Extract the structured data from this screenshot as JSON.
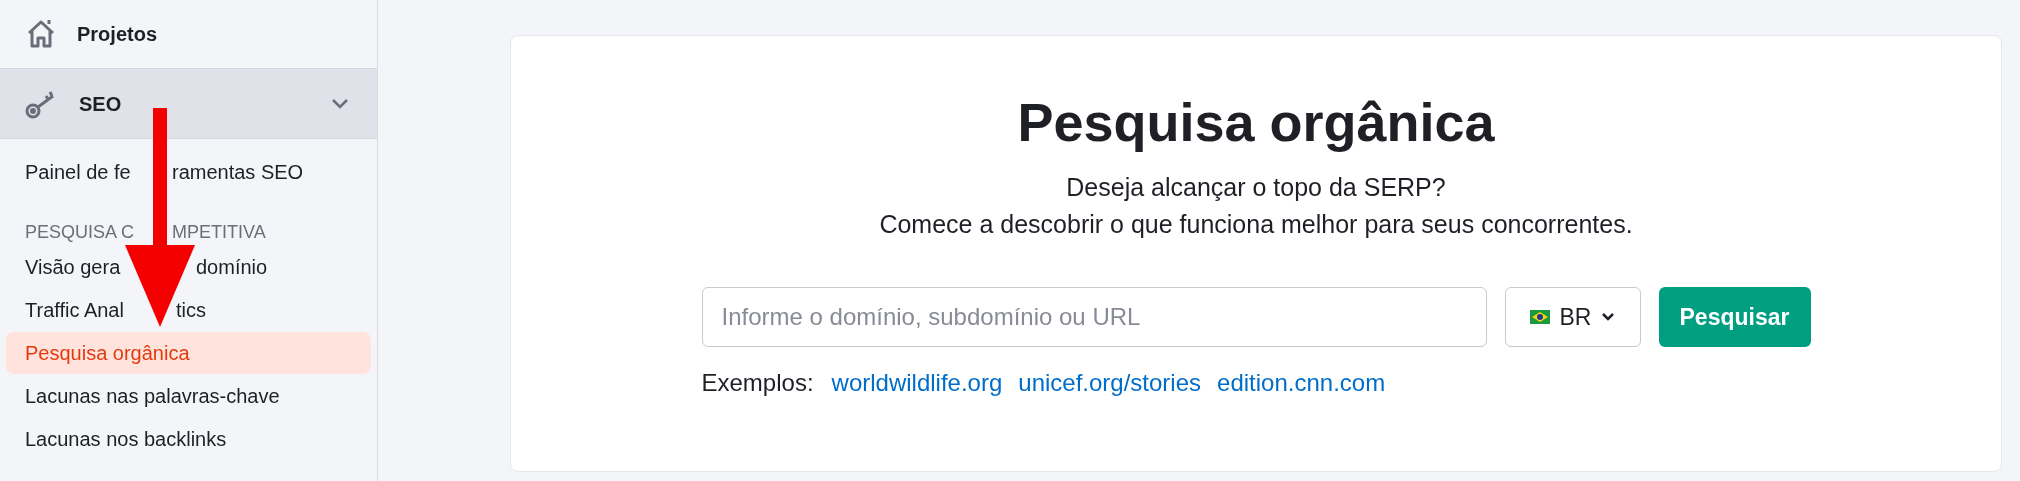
{
  "sidebar": {
    "top_item": {
      "label": "Projetos"
    },
    "section": {
      "label": "SEO",
      "expanded": true
    },
    "items": [
      {
        "kind": "item",
        "label_parts": [
          "Painel de fe",
          "ramentas SEO"
        ],
        "selected": false
      },
      {
        "kind": "heading",
        "label_parts": [
          "PESQUISA C",
          "MPETITIVA"
        ]
      },
      {
        "kind": "item",
        "label_parts": [
          "Visão gera",
          "domínio"
        ],
        "selected": false
      },
      {
        "kind": "item",
        "label_parts": [
          "Traffic Anal",
          "tics"
        ],
        "selected": false
      },
      {
        "kind": "item",
        "label": "Pesquisa orgânica",
        "selected": true
      },
      {
        "kind": "item",
        "label": "Lacunas nas palavras-chave",
        "selected": false
      },
      {
        "kind": "item",
        "label": "Lacunas nos backlinks",
        "selected": false
      }
    ]
  },
  "main": {
    "title": "Pesquisa orgânica",
    "subtitle": [
      "Deseja alcançar o topo da SERP?",
      "Comece a descobrir o que funciona melhor para seus concorrentes."
    ],
    "search": {
      "placeholder": "Informe o domínio, subdomínio ou URL"
    },
    "country": {
      "value": "BR"
    },
    "button": "Pesquisar",
    "examples_label": "Exemplos:",
    "examples": [
      "worldwildlife.org",
      "unicef.org/stories",
      "edition.cnn.com"
    ]
  }
}
